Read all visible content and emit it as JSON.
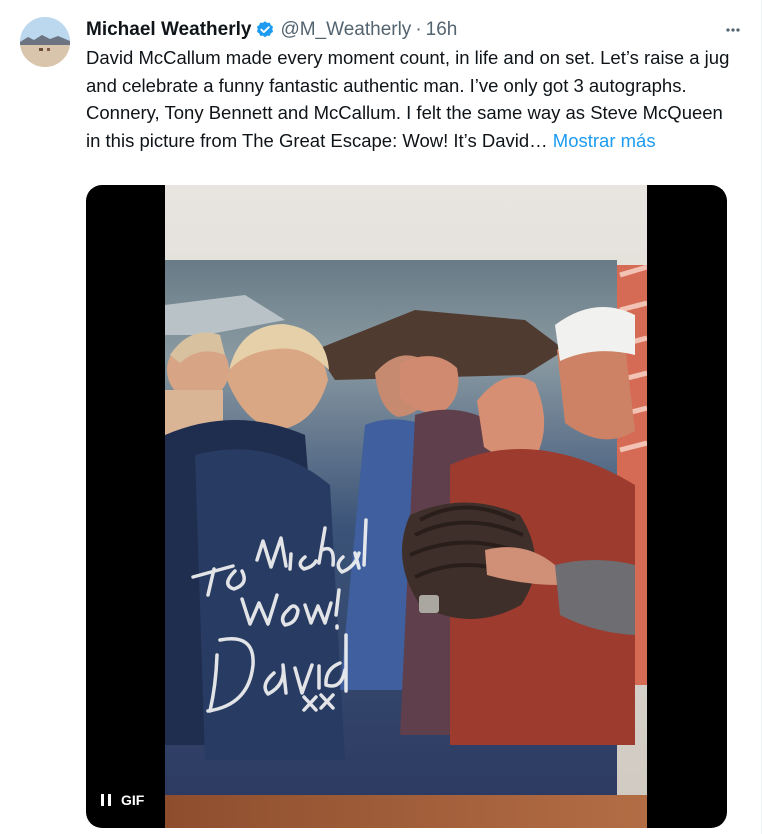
{
  "tweet": {
    "author_name": "Michael Weatherly",
    "handle": "@M_Weatherly",
    "separator": "·",
    "time": "16h",
    "text": "David McCallum made every moment count, in life and on set. Let’s raise a jug and celebrate a funny fantastic authentic man. I’ve only got 3 autographs. Connery, Tony Bennett and McCallum. I felt the same way as Steve McQueen in this picture from The Great Escape: Wow! It’s David…",
    "show_more": "Mostrar más"
  },
  "media": {
    "gif_label": "GIF",
    "autograph_lines": [
      "To Michael",
      "Wow!",
      "David",
      "xx"
    ]
  },
  "icons": {
    "verified": "verified-badge-icon",
    "more": "more-icon",
    "pause": "pause-icon"
  },
  "colors": {
    "link": "#1d9bf0",
    "secondary_text": "#536471",
    "verified": "#1d9bf0"
  }
}
